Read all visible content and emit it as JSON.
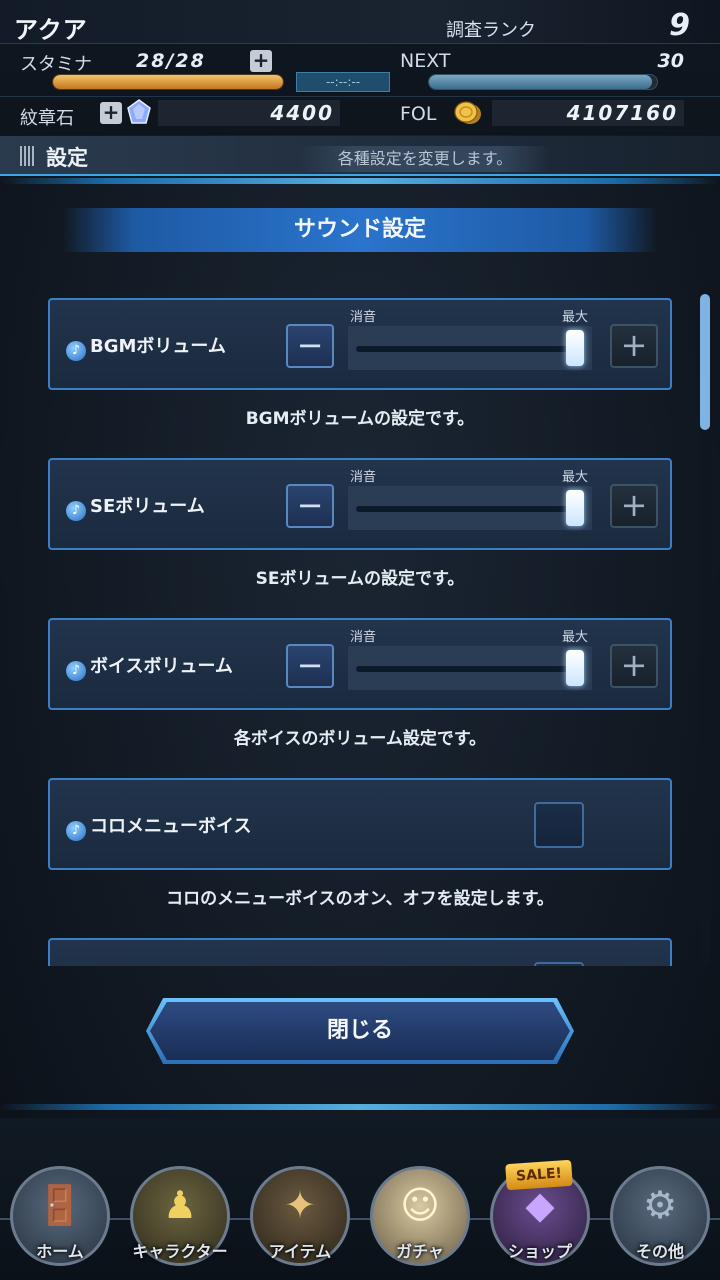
{
  "header": {
    "player_name": "アクア",
    "rank_label": "調査ランク",
    "rank_value": "9",
    "stamina_label": "スタミナ",
    "stamina_value": "28/28",
    "stamina_fill": 1.0,
    "timer": "--:--:--",
    "next_label": "NEXT",
    "next_value": "30",
    "exp_fill": 0.98,
    "crest_label": "紋章石",
    "crest_value": "4400",
    "fol_label": "FOL",
    "fol_value": "4107160"
  },
  "section": {
    "title": "設定",
    "description": "各種設定を変更します。"
  },
  "panel": {
    "heading": "サウンド設定",
    "settings": [
      {
        "label": "BGMボリューム",
        "type": "slider",
        "min_label": "消音",
        "max_label": "最大",
        "value": 1.0,
        "description": "BGMボリュームの設定です。"
      },
      {
        "label": "SEボリューム",
        "type": "slider",
        "min_label": "消音",
        "max_label": "最大",
        "value": 1.0,
        "description": "SEボリュームの設定です。"
      },
      {
        "label": "ボイスボリューム",
        "type": "slider",
        "min_label": "消音",
        "max_label": "最大",
        "value": 1.0,
        "description": "各ボイスのボリューム設定です。"
      },
      {
        "label": "コロメニューボイス",
        "type": "toggle",
        "checked": false,
        "description": "コロのメニューボイスのオン、オフを設定します。"
      }
    ]
  },
  "close_button": "閉じる",
  "nav": [
    {
      "label": "ホーム",
      "icon": "home-door-icon"
    },
    {
      "label": "キャラクター",
      "icon": "characters-icon"
    },
    {
      "label": "アイテム",
      "icon": "item-bag-icon"
    },
    {
      "label": "ガチャ",
      "icon": "gacha-icon"
    },
    {
      "label": "ショップ",
      "icon": "shop-crystal-icon",
      "badge": "SALE!"
    },
    {
      "label": "その他",
      "icon": "gears-icon"
    }
  ],
  "colors": {
    "accent": "#3aa7e8",
    "card_border": "#3d7fc4",
    "stamina": "#e0a040"
  }
}
